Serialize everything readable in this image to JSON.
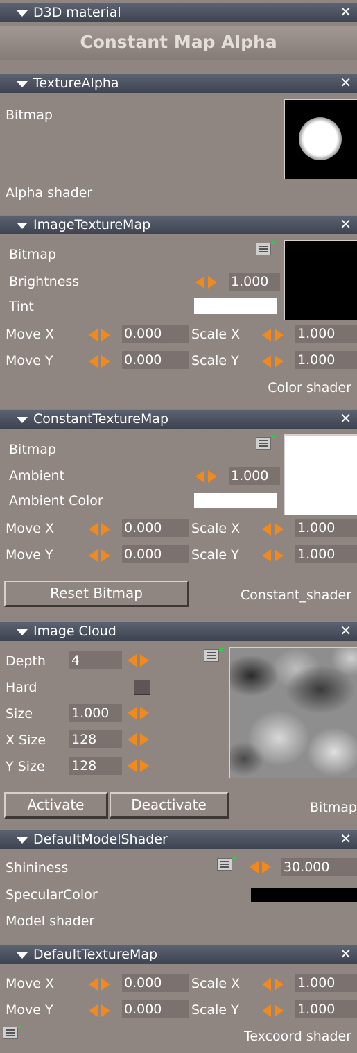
{
  "panels": {
    "d3d": {
      "title": "D3D material",
      "name": "Constant Map Alpha"
    },
    "texture_alpha": {
      "title": "TextureAlpha",
      "bitmap_label": "Bitmap",
      "footer": "Alpha  shader"
    },
    "image_texture_map": {
      "title": "ImageTextureMap",
      "bitmap_label": "Bitmap",
      "brightness_label": "Brightness",
      "brightness_value": "1.000",
      "tint_label": "Tint",
      "tint_color": "#ffffff",
      "move_x_label": "Move  X",
      "move_x_value": "0.000",
      "scale_x_label": "Scale  X",
      "scale_x_value": "1.000",
      "move_y_label": "Move  Y",
      "move_y_value": "0.000",
      "scale_y_label": "Scale  Y",
      "scale_y_value": "1.000",
      "footer": "Color  shader"
    },
    "constant_texture_map": {
      "title": "ConstantTextureMap",
      "bitmap_label": "Bitmap",
      "ambient_label": "Ambient",
      "ambient_value": "1.000",
      "ambient_color_label": "Ambient  Color",
      "ambient_color": "#ffffff",
      "move_x_label": "Move  X",
      "move_x_value": "0.000",
      "scale_x_label": "Scale  X",
      "scale_x_value": "1.000",
      "move_y_label": "Move  Y",
      "move_y_value": "0.000",
      "scale_y_label": "Scale  Y",
      "scale_y_value": "1.000",
      "reset_button": "Reset Bitmap",
      "footer": "Constant_shader"
    },
    "image_cloud": {
      "title": "Image Cloud",
      "depth_label": "Depth",
      "depth_value": "4",
      "hard_label": "Hard",
      "size_label": "Size",
      "size_value": "1.000",
      "xsize_label": "X Size",
      "xsize_value": "128",
      "ysize_label": "Y Size",
      "ysize_value": "128",
      "activate_button": "Activate",
      "deactivate_button": "Deactivate",
      "footer": "Bitmap"
    },
    "default_model_shader": {
      "title": "DefaultModelShader",
      "shininess_label": "Shininess",
      "shininess_value": "30.000",
      "specular_label": "SpecularColor",
      "specular_color": "#000000",
      "footer": "Model  shader"
    },
    "default_texture_map": {
      "title": "DefaultTextureMap",
      "move_x_label": "Move  X",
      "move_x_value": "0.000",
      "scale_x_label": "Scale  X",
      "scale_x_value": "1.000",
      "move_y_label": "Move  Y",
      "move_y_value": "0.000",
      "scale_y_label": "Scale  Y",
      "scale_y_value": "1.000",
      "footer": "Texcoord  shader"
    }
  },
  "colors": {
    "accent_arrow": "#f08a1e",
    "header_bg": "#454b58",
    "panel_bg": "#8f8581"
  },
  "icons": {
    "collapse": "triangle-down",
    "close": "close-x",
    "spinner": "left-right-arrows",
    "list": "list-menu"
  }
}
